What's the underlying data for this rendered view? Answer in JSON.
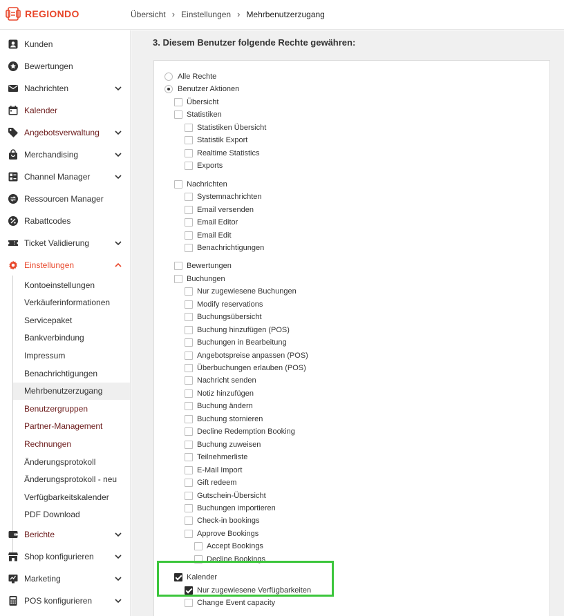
{
  "brand": {
    "name": "REGIONDO",
    "color": "#e8472b"
  },
  "breadcrumb": [
    {
      "label": "Übersicht"
    },
    {
      "label": "Einstellungen"
    },
    {
      "label": "Mehrbenutzerzugang"
    }
  ],
  "sidebar": {
    "items": [
      {
        "label": "Kunden",
        "icon": "user-card-icon",
        "chevron": false,
        "style": "normal"
      },
      {
        "label": "Bewertungen",
        "icon": "star-icon",
        "chevron": false,
        "style": "normal"
      },
      {
        "label": "Nachrichten",
        "icon": "envelope-icon",
        "chevron": true,
        "style": "normal"
      },
      {
        "label": "Kalender",
        "icon": "calendar-icon",
        "chevron": false,
        "style": "dark-red"
      },
      {
        "label": "Angebotsverwaltung",
        "icon": "tag-icon",
        "chevron": true,
        "style": "dark-red"
      },
      {
        "label": "Merchandising",
        "icon": "shopping-bag-icon",
        "chevron": true,
        "style": "normal"
      },
      {
        "label": "Channel Manager",
        "icon": "channel-icon",
        "chevron": true,
        "style": "normal"
      },
      {
        "label": "Ressourcen Manager",
        "icon": "swap-icon",
        "chevron": false,
        "style": "normal"
      },
      {
        "label": "Rabattcodes",
        "icon": "percent-icon",
        "chevron": false,
        "style": "normal"
      },
      {
        "label": "Ticket Validierung",
        "icon": "ticket-icon",
        "chevron": true,
        "style": "normal"
      },
      {
        "label": "Einstellungen",
        "icon": "gear-icon",
        "chevron": true,
        "style": "active"
      }
    ],
    "subitems": [
      {
        "label": "Kontoeinstellungen",
        "style": "normal"
      },
      {
        "label": "Verkäuferinformationen",
        "style": "normal"
      },
      {
        "label": "Servicepaket",
        "style": "normal"
      },
      {
        "label": "Bankverbindung",
        "style": "normal"
      },
      {
        "label": "Impressum",
        "style": "normal"
      },
      {
        "label": "Benachrichtigungen",
        "style": "normal"
      },
      {
        "label": "Mehrbenutzerzugang",
        "style": "selected"
      },
      {
        "label": "Benutzergruppen",
        "style": "red"
      },
      {
        "label": "Partner-Management",
        "style": "red"
      },
      {
        "label": "Rechnungen",
        "style": "red"
      },
      {
        "label": "Änderungsprotokoll",
        "style": "normal"
      },
      {
        "label": "Änderungsprotokoll - neu",
        "style": "normal"
      },
      {
        "label": "Verfügbarkeitskalender",
        "style": "normal"
      },
      {
        "label": "PDF Download",
        "style": "normal"
      }
    ],
    "bottom_items": [
      {
        "label": "Berichte",
        "icon": "wallet-icon",
        "chevron": true,
        "style": "dark-red"
      },
      {
        "label": "Shop konfigurieren",
        "icon": "shop-icon",
        "chevron": true,
        "style": "normal"
      },
      {
        "label": "Marketing",
        "icon": "marketing-icon",
        "chevron": true,
        "style": "normal"
      },
      {
        "label": "POS konfigurieren",
        "icon": "calculator-icon",
        "chevron": true,
        "style": "normal"
      }
    ]
  },
  "main": {
    "section_title": "3. Diesem Benutzer folgende Rechte gewähren:",
    "radios": [
      {
        "label": "Alle Rechte",
        "selected": false
      },
      {
        "label": "Benutzer Aktionen",
        "selected": true
      }
    ],
    "permissions": [
      {
        "label": "Übersicht",
        "level": 0,
        "checked": false
      },
      {
        "label": "Statistiken",
        "level": 0,
        "checked": false
      },
      {
        "label": "Statistiken Übersicht",
        "level": 1,
        "checked": false
      },
      {
        "label": "Statistik Export",
        "level": 1,
        "checked": false
      },
      {
        "label": "Realtime Statistics",
        "level": 1,
        "checked": false
      },
      {
        "label": "Exports",
        "level": 1,
        "checked": false
      },
      {
        "label": "Nachrichten",
        "level": 0,
        "checked": false,
        "gap": true
      },
      {
        "label": "Systemnachrichten",
        "level": 1,
        "checked": false
      },
      {
        "label": "Email versenden",
        "level": 1,
        "checked": false
      },
      {
        "label": "Email Editor",
        "level": 1,
        "checked": false
      },
      {
        "label": "Email Edit",
        "level": 1,
        "checked": false
      },
      {
        "label": "Benachrichtigungen",
        "level": 1,
        "checked": false
      },
      {
        "label": "Bewertungen",
        "level": 0,
        "checked": false,
        "gap": true
      },
      {
        "label": "Buchungen",
        "level": 0,
        "checked": false
      },
      {
        "label": "Nur zugewiesene Buchungen",
        "level": 1,
        "checked": false
      },
      {
        "label": "Modify reservations",
        "level": 1,
        "checked": false
      },
      {
        "label": "Buchungsübersicht",
        "level": 1,
        "checked": false
      },
      {
        "label": "Buchung hinzufügen (POS)",
        "level": 1,
        "checked": false
      },
      {
        "label": "Buchungen in Bearbeitung",
        "level": 1,
        "checked": false
      },
      {
        "label": "Angebotspreise anpassen (POS)",
        "level": 1,
        "checked": false
      },
      {
        "label": "Überbuchungen erlauben (POS)",
        "level": 1,
        "checked": false
      },
      {
        "label": "Nachricht senden",
        "level": 1,
        "checked": false
      },
      {
        "label": "Notiz hinzufügen",
        "level": 1,
        "checked": false
      },
      {
        "label": "Buchung ändern",
        "level": 1,
        "checked": false
      },
      {
        "label": "Buchung stornieren",
        "level": 1,
        "checked": false
      },
      {
        "label": "Decline Redemption Booking",
        "level": 1,
        "checked": false
      },
      {
        "label": "Buchung zuweisen",
        "level": 1,
        "checked": false
      },
      {
        "label": "Teilnehmerliste",
        "level": 1,
        "checked": false
      },
      {
        "label": "E-Mail Import",
        "level": 1,
        "checked": false
      },
      {
        "label": "Gift redeem",
        "level": 1,
        "checked": false
      },
      {
        "label": "Gutschein-Übersicht",
        "level": 1,
        "checked": false
      },
      {
        "label": "Buchungen importieren",
        "level": 1,
        "checked": false
      },
      {
        "label": "Check-in bookings",
        "level": 1,
        "checked": false
      },
      {
        "label": "Approve Bookings",
        "level": 1,
        "checked": false
      },
      {
        "label": "Accept Bookings",
        "level": 2,
        "checked": false
      },
      {
        "label": "Decline Bookings",
        "level": 2,
        "checked": false
      },
      {
        "label": "Kalender",
        "level": 0,
        "checked": true,
        "gap": true
      },
      {
        "label": "Nur zugewiesene Verfügbarkeiten",
        "level": 1,
        "checked": true
      },
      {
        "label": "Change Event capacity",
        "level": 1,
        "checked": false
      }
    ],
    "highlight_color": "#3cc63c"
  }
}
